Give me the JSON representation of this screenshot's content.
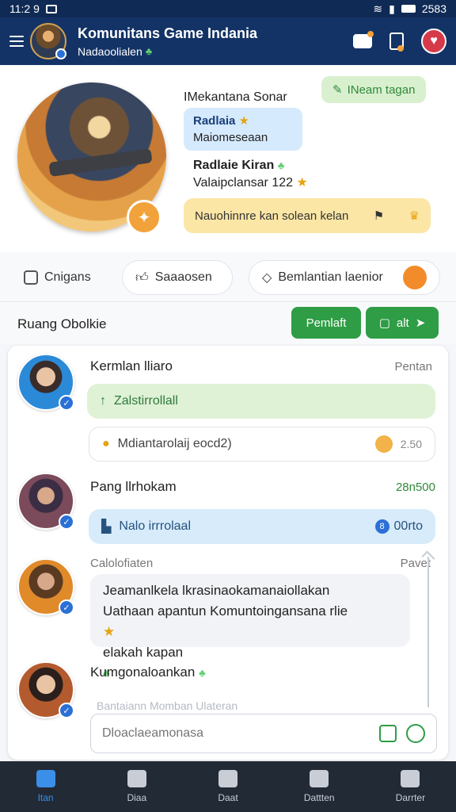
{
  "status": {
    "time": "11:2 9",
    "right": "2583"
  },
  "header": {
    "title": "Komunitans Game Indania",
    "subtitle": "Nadaoolialen"
  },
  "profile": {
    "name": "IMekantana Sonar",
    "tag": "INeam tagan",
    "blue_line1": "Radlaia",
    "blue_line2": "Maiomeseaan",
    "line1": "Radlaie Kiran",
    "line2": "Valaipclansar 122",
    "yellow_text": "Nauohinnre kan solean kelan"
  },
  "chips": {
    "c1": "Cnigans",
    "c2": "Saaaosen",
    "c3": "Bemlantian laenior"
  },
  "room": {
    "title": "Ruang Obolkie",
    "btn1": "Pemlaft",
    "btn2": "alt"
  },
  "feed": {
    "u1_name": "Kermlan lliaro",
    "u1_side": "Pentan",
    "u1_green": "Zalstirrollall",
    "u1_white": "Mdiantarolaij eocd2)",
    "u1_white_time": "2.50",
    "u2_name": "Pang llrhokam",
    "u2_side": "28n500",
    "u2_blue": "Nalo irrrolaal",
    "u2_blue_num": "00rto",
    "u3_name": "Calolofiaten",
    "u3_side": "Pavet",
    "u3_msg1": "Jeamanlkela lkrasinaokamanaiollakan",
    "u3_msg2": "Uathaan apantun Komuntoingansana rlie",
    "u3_msg3": "elakah kapan",
    "u4_name": "Kumgonaloankan",
    "faded": "Bantaiann Momban Ulateran"
  },
  "composer": {
    "placeholder": "Dloaclaeamonasa"
  },
  "tabs": [
    "Itan",
    "Diaa",
    "Daat",
    "Dattten",
    "Darrter"
  ]
}
